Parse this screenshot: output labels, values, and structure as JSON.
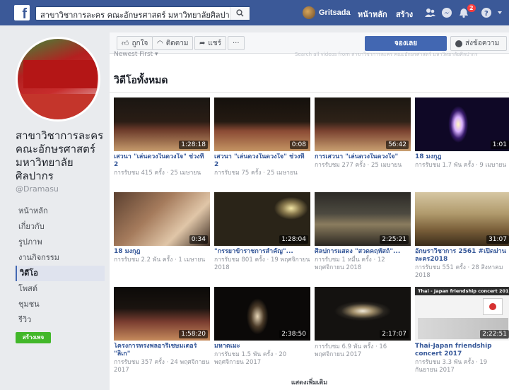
{
  "topbar": {
    "search_value": "สาขาวิชาการละคร คณะอักษรศาสตร์ มหาวิทยาลัยศิลปากร",
    "user_name": "Gritsada",
    "home_label": "หน้าหลัก",
    "create_label": "สร้าง",
    "notification_count": "2",
    "brand_color": "#3b5998"
  },
  "actions": {
    "like_label": "ถูกใจ",
    "follow_label": "ติดตาม",
    "share_label": "แชร์",
    "more_label": "···",
    "book_label": "จองเลย",
    "message_label": "ส่งข้อความ"
  },
  "page": {
    "name": "สาขาวิชาการละคร คณะอักษรศาสตร์ มหาวิทยาลัย ศิลปากร",
    "handle": "@Dramasu",
    "nav": [
      {
        "label": "หน้าหลัก"
      },
      {
        "label": "เกี่ยวกับ"
      },
      {
        "label": "รูปภาพ"
      },
      {
        "label": "งานกิจกรรม"
      },
      {
        "label": "วิดีโอ"
      },
      {
        "label": "โพสต์"
      },
      {
        "label": "ชุมชน"
      },
      {
        "label": "รีวิว"
      }
    ],
    "create_label": "สร้างเพจ"
  },
  "main": {
    "sort_label": "Newest First ▾",
    "search_placeholder": "Search all videos from สาขาวิชาการละคร คณะอักษรศาสตร์ มหาวิทยาลัยศิลปากร",
    "section_title": "วิดีโอทั้งหมด",
    "more_label": "แสดงเพิ่มเติม",
    "videos": [
      {
        "title": "เสวนา \"เล่นดวงในดวงใจ\" ช่วงที่ 2",
        "duration": "1:28:18",
        "views": "การรับชม 415 ครั้ง · 25 เมษายน"
      },
      {
        "title": "เสวนา \"เล่นดวงในดวงใจ\" ช่วงที่ 2",
        "duration": "0:08",
        "views": "การรับชม 75 ครั้ง · 25 เมษายน"
      },
      {
        "title": "การเสวนา \"เล่นดวงในดวงใจ\"",
        "duration": "56:42",
        "views": "การรับชม 277 ครั้ง · 25 เมษายน"
      },
      {
        "title": "18 มงกุฎ",
        "duration": "1:01",
        "views": "การรับชม 1.7 พัน ครั้ง · 9 เมษายน"
      },
      {
        "title": "18 มงกุฎ",
        "duration": "0:34",
        "views": "การรับชม 2.2 พัน ครั้ง · 1 เมษายน"
      },
      {
        "title": "\"กรรยาข้าราชการสำคัญ\"...",
        "duration": "1:28:04",
        "views": "การรับชม 801 ครั้ง · 19 พฤศจิกายน 2018"
      },
      {
        "title": "ศิลปการแสดง \"สวดคฤหัสถ์\"...",
        "duration": "2:25:21",
        "views": "การรับชม 1 หมื่น ครั้ง · 12 พฤศจิกายน 2018"
      },
      {
        "title": "อักษราวิชาการ 2561 #เปิดม่านละคร2018",
        "duration": "31:07",
        "views": "การรับชม 551 ครั้ง · 28 สิงหาคม 2018"
      },
      {
        "title": "โครงการทรงพลอารีเชษมเตอร์ \"ลิเก\"",
        "duration": "1:58:20",
        "views": "การรับชม 357 ครั้ง · 24 พฤศจิกายน 2017"
      },
      {
        "title": "มหาดเมะ",
        "duration": "2:38:50",
        "views": "การรับชม 1.5 พัน ครั้ง · 20 พฤศจิกายน 2017"
      },
      {
        "title": "",
        "duration": "2:17:07",
        "views": "การรับชม 6.9 พัน ครั้ง · 16 พฤศจิกายน 2017"
      },
      {
        "title": "Thai-Japan friendship concert 2017",
        "duration": "2:22:51",
        "views": "การรับชม 3.3 พัน ครั้ง · 19 กันยายน 2017",
        "thumb_caption": "Thai - Japan friendship concert 2017"
      }
    ]
  }
}
